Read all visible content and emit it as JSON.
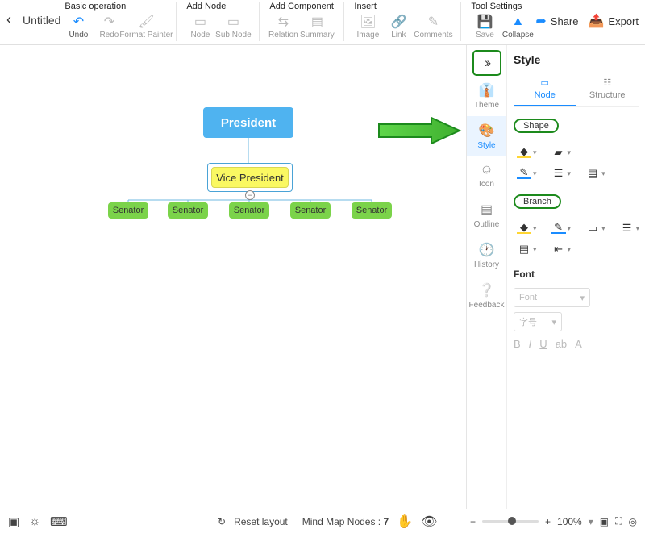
{
  "doc": {
    "title": "Untitled"
  },
  "toolbar": {
    "groups": {
      "basic": {
        "label": "Basic operation",
        "undo": "Undo",
        "redo": "Redo",
        "format_painter": "Format Painter"
      },
      "add_node": {
        "label": "Add Node",
        "node": "Node",
        "sub_node": "Sub Node"
      },
      "add_component": {
        "label": "Add Component",
        "relation": "Relation",
        "summary": "Summary"
      },
      "insert": {
        "label": "Insert",
        "image": "Image",
        "link": "Link",
        "comments": "Comments"
      },
      "tool_settings": {
        "label": "Tool Settings",
        "save": "Save",
        "collapse": "Collapse"
      }
    },
    "share": "Share",
    "export": "Export"
  },
  "mindmap": {
    "president": "President",
    "vice_president": "Vice President",
    "senators": [
      "Senator",
      "Senator",
      "Senator",
      "Senator",
      "Senator"
    ]
  },
  "rail": {
    "theme": "Theme",
    "style": "Style",
    "icon": "Icon",
    "outline": "Outline",
    "history": "History",
    "feedback": "Feedback"
  },
  "panel": {
    "title": "Style",
    "tabs": {
      "node": "Node",
      "structure": "Structure"
    },
    "shape_label": "Shape",
    "branch_label": "Branch",
    "font_title": "Font",
    "font_placeholder": "Font",
    "size_placeholder": "字号",
    "font_buttons": {
      "b": "B",
      "i": "I",
      "u": "U",
      "ab": "ab",
      "a": "A"
    }
  },
  "status": {
    "reset_layout": "Reset layout",
    "nodes_label": "Mind Map Nodes :",
    "nodes_count": "7",
    "zoom": "100%"
  }
}
